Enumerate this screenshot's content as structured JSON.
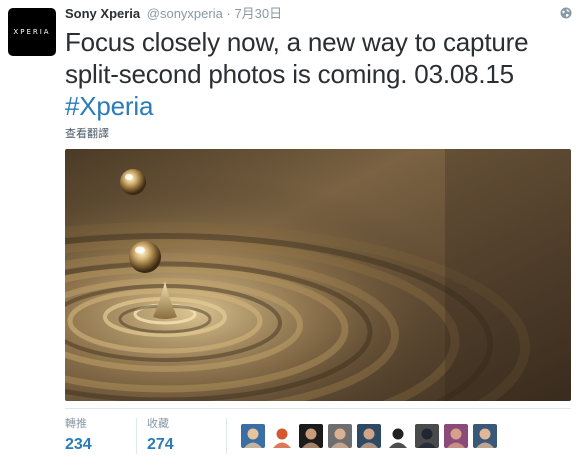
{
  "tweet": {
    "avatar_text": "XPERIA",
    "display_name": "Sony Xperia",
    "handle": "@sonyxperia",
    "separator": "·",
    "timestamp": "7月30日",
    "text_line1": "Focus closely now, a new way to capture",
    "text_line2": "split-second photos is coming. 03.08.15",
    "hashtag": "#Xperia",
    "translate_label": "查看翻譯"
  },
  "stats": {
    "retweets_label": "轉推",
    "retweets_value": "234",
    "likes_label": "收藏",
    "likes_value": "274"
  },
  "colors": {
    "link_blue": "#2b7bb9",
    "meta_gray": "#8899a6",
    "text_dark": "#292f33",
    "photo_gold": "#b89a66"
  },
  "icons": {
    "globe": "globe-icon"
  },
  "likers": [
    {
      "name": "liker-avatar",
      "bg": "#3a6ea5",
      "fg": "#e8c49a"
    },
    {
      "name": "liker-avatar",
      "bg": "#ffffff",
      "fg": "#d4572e"
    },
    {
      "name": "liker-avatar",
      "bg": "#1b1b1b",
      "fg": "#c89c78"
    },
    {
      "name": "liker-avatar",
      "bg": "#6e6e6e",
      "fg": "#d9b293"
    },
    {
      "name": "liker-avatar",
      "bg": "#2e4a63",
      "fg": "#cfa58a"
    },
    {
      "name": "liker-avatar",
      "bg": "#ffffff",
      "fg": "#222222"
    },
    {
      "name": "liker-avatar",
      "bg": "#4a4a4a",
      "fg": "#1f2733"
    },
    {
      "name": "liker-avatar",
      "bg": "#8a4a7a",
      "fg": "#d7a08a"
    },
    {
      "name": "liker-avatar",
      "bg": "#3a5878",
      "fg": "#e0b899"
    }
  ]
}
